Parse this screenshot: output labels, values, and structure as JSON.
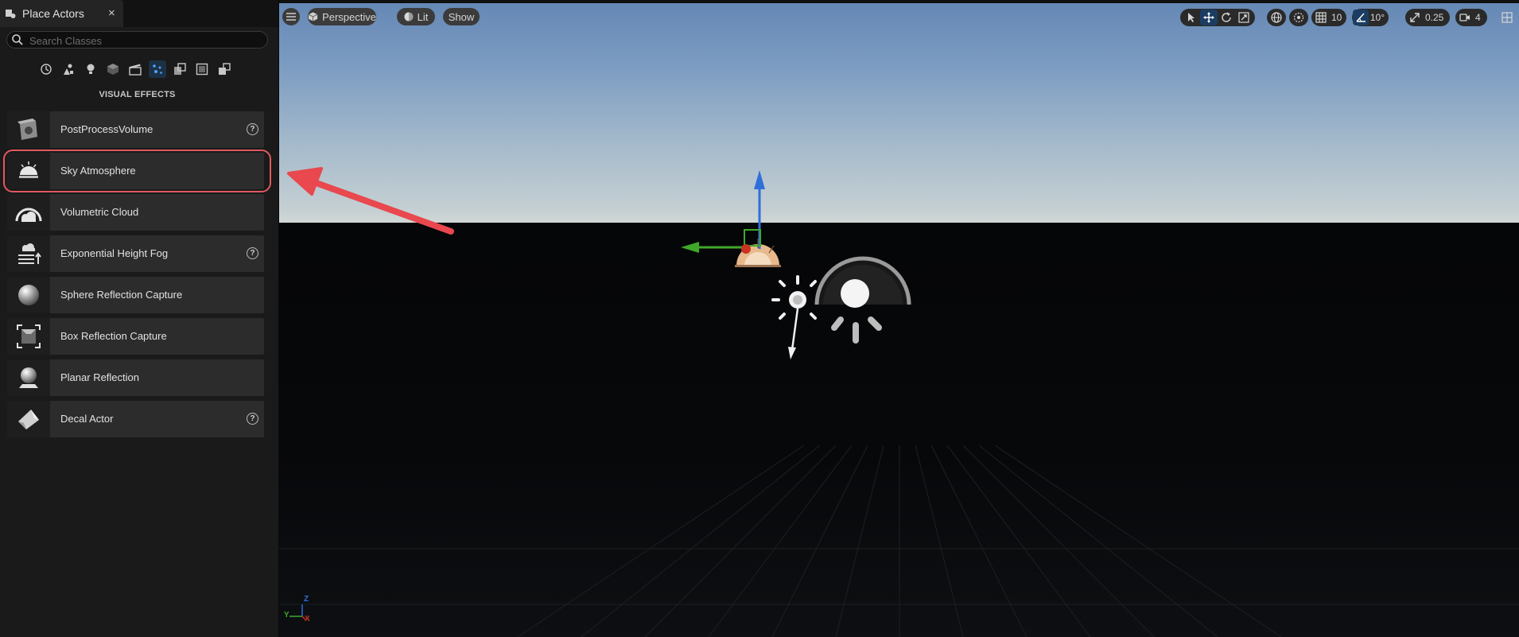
{
  "panel": {
    "tab_title": "Place Actors",
    "tab_close": "×",
    "search_placeholder": "Search Classes",
    "category_icons": [
      "recent-icon",
      "basic-icon",
      "lights-icon",
      "shapes-icon",
      "cinematic-icon",
      "visual-effects-icon",
      "volumes-icon",
      "all-classes-icon",
      "geometry-icon"
    ],
    "active_category": "visual-effects-icon",
    "category_label": "VISUAL EFFECTS",
    "items": [
      {
        "label": "PostProcessVolume",
        "icon": "post-process-volume-icon",
        "help": true
      },
      {
        "label": "Sky Atmosphere",
        "icon": "sky-atmosphere-icon",
        "help": false
      },
      {
        "label": "Volumetric Cloud",
        "icon": "volumetric-cloud-icon",
        "help": false
      },
      {
        "label": "Exponential Height Fog",
        "icon": "height-fog-icon",
        "help": true
      },
      {
        "label": "Sphere Reflection Capture",
        "icon": "sphere-reflection-icon",
        "help": false
      },
      {
        "label": "Box Reflection Capture",
        "icon": "box-reflection-icon",
        "help": false
      },
      {
        "label": "Planar Reflection",
        "icon": "planar-reflection-icon",
        "help": false
      },
      {
        "label": "Decal Actor",
        "icon": "decal-actor-icon",
        "help": true
      }
    ],
    "help_glyph": "?"
  },
  "viewport": {
    "view_mode": "Perspective",
    "lighting_mode": "Lit",
    "show_label": "Show",
    "grid_snap": "10",
    "rotation_snap": "10°",
    "scale_snap": "0.25",
    "camera_speed": "4",
    "axis_labels": {
      "y": "Y",
      "z": "Z",
      "x": "X"
    }
  },
  "colors": {
    "accent": "#2f7fd8",
    "highlight": "#e05a5f"
  }
}
